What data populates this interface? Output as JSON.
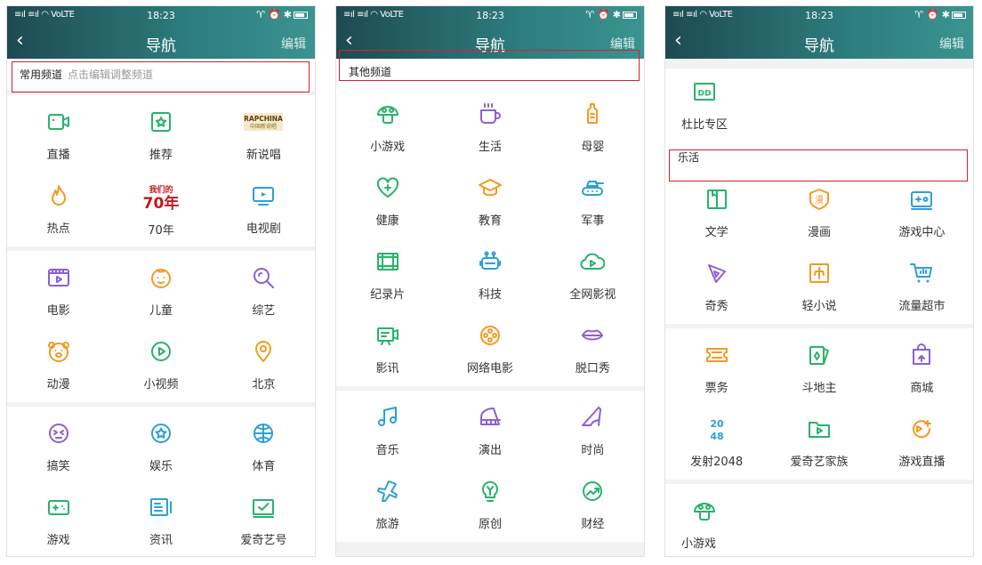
{
  "screens": [
    {
      "status": {
        "signal": "≡ıl ≡ıl ◠ VoLTE",
        "time": "18:23",
        "right": "♈ ⏰ ✱"
      },
      "nav": {
        "back": "‹",
        "title": "导航",
        "edit": "编辑"
      },
      "section_title": "常用频道",
      "section_hint": "点击编辑调整频道",
      "blocks": [
        [
          {
            "label": "直播",
            "icon": "live-icon",
            "color": "#27b36b"
          },
          {
            "label": "推荐",
            "icon": "recommend-icon",
            "color": "#27b36b"
          },
          {
            "label": "新说唱",
            "icon": "rapchina-logo",
            "color": "#8a6b1f"
          },
          {
            "label": "热点",
            "icon": "flame-icon",
            "color": "#f39a22"
          },
          {
            "label": "70年",
            "icon": "70-years-logo",
            "color": "#c4161c"
          },
          {
            "label": "电视剧",
            "icon": "tv-icon",
            "color": "#2d9fd8"
          }
        ],
        [
          {
            "label": "电影",
            "icon": "film-icon",
            "color": "#8e5fd0"
          },
          {
            "label": "儿童",
            "icon": "child-face-icon",
            "color": "#f39a22"
          },
          {
            "label": "综艺",
            "icon": "magnifier-icon",
            "color": "#8e5fd0"
          },
          {
            "label": "动漫",
            "icon": "bear-icon",
            "color": "#f39a22"
          },
          {
            "label": "小视频",
            "icon": "play-circle-icon",
            "color": "#27b36b"
          },
          {
            "label": "北京",
            "icon": "location-pin-icon",
            "color": "#f39a22"
          }
        ],
        [
          {
            "label": "搞笑",
            "icon": "funny-face-icon",
            "color": "#8e5fd0"
          },
          {
            "label": "娱乐",
            "icon": "star-circle-icon",
            "color": "#2d9fd8"
          },
          {
            "label": "体育",
            "icon": "ball-icon",
            "color": "#2d9fd8"
          },
          {
            "label": "游戏",
            "icon": "gamepad-icon",
            "color": "#27b36b"
          },
          {
            "label": "资讯",
            "icon": "news-icon",
            "color": "#2d9fd8"
          },
          {
            "label": "爱奇艺号",
            "icon": "check-box-icon",
            "color": "#27b36b"
          }
        ]
      ]
    },
    {
      "status": {
        "signal": "≡ıl ≡ıl ◠ VoLTE",
        "time": "18:23",
        "right": "♈ ⏰ ✱"
      },
      "nav": {
        "back": "‹",
        "title": "导航",
        "edit": "编辑"
      },
      "section_title": "其他频道",
      "blocks": [
        [
          {
            "label": "小游戏",
            "icon": "mushroom-icon",
            "color": "#27b36b"
          },
          {
            "label": "生活",
            "icon": "cup-icon",
            "color": "#8e5fd0"
          },
          {
            "label": "母婴",
            "icon": "baby-bottle-icon",
            "color": "#f39a22"
          },
          {
            "label": "健康",
            "icon": "heart-icon",
            "color": "#27b36b"
          },
          {
            "label": "教育",
            "icon": "graduation-cap-icon",
            "color": "#f39a22"
          },
          {
            "label": "军事",
            "icon": "tank-icon",
            "color": "#2d9fd8"
          },
          {
            "label": "纪录片",
            "icon": "filmstrip-icon",
            "color": "#27b36b"
          },
          {
            "label": "科技",
            "icon": "robot-icon",
            "color": "#2d9fd8"
          },
          {
            "label": "全网影视",
            "icon": "cloud-play-icon",
            "color": "#27b36b"
          },
          {
            "label": "影讯",
            "icon": "camera-screen-icon",
            "color": "#27b36b"
          },
          {
            "label": "网络电影",
            "icon": "film-reel-icon",
            "color": "#f39a22"
          },
          {
            "label": "脱口秀",
            "icon": "lips-icon",
            "color": "#8e5fd0"
          }
        ],
        [
          {
            "label": "音乐",
            "icon": "music-note-icon",
            "color": "#2d9fd8"
          },
          {
            "label": "演出",
            "icon": "piano-icon",
            "color": "#8e5fd0"
          },
          {
            "label": "时尚",
            "icon": "high-heel-icon",
            "color": "#8e5fd0"
          },
          {
            "label": "旅游",
            "icon": "plane-icon",
            "color": "#2d9fd8"
          },
          {
            "label": "原创",
            "icon": "bulb-icon",
            "color": "#27b36b"
          },
          {
            "label": "财经",
            "icon": "trend-icon",
            "color": "#27b36b"
          }
        ]
      ]
    },
    {
      "status": {
        "signal": "≡ıl ≡ıl ◠ VoLTE",
        "time": "18:23",
        "right": "♈ ⏰ ✱"
      },
      "nav": {
        "back": "‹",
        "title": "导航",
        "edit": "编辑"
      },
      "top_block": [
        {
          "label": "杜比专区",
          "icon": "dolby-icon",
          "color": "#27b36b"
        }
      ],
      "section_title": "乐活",
      "blocks": [
        [
          {
            "label": "文学",
            "icon": "book-icon",
            "color": "#27b36b"
          },
          {
            "label": "漫画",
            "icon": "manhua-icon",
            "color": "#f39a22",
            "glyph": "漫"
          },
          {
            "label": "游戏中心",
            "icon": "game-center-icon",
            "color": "#2d9fd8"
          },
          {
            "label": "奇秀",
            "icon": "qixiu-icon",
            "color": "#8e5fd0"
          },
          {
            "label": "轻小说",
            "icon": "light-novel-icon",
            "color": "#f39a22"
          },
          {
            "label": "流量超市",
            "icon": "cart-icon",
            "color": "#2d9fd8"
          }
        ],
        [
          {
            "label": "票务",
            "icon": "ticket-icon",
            "color": "#f39a22"
          },
          {
            "label": "斗地主",
            "icon": "cards-icon",
            "color": "#27b36b"
          },
          {
            "label": "商城",
            "icon": "shop-bag-icon",
            "color": "#8e5fd0"
          },
          {
            "label": "发射2048",
            "icon": "2048-icon",
            "color": "#2d9fd8"
          },
          {
            "label": "爱奇艺家族",
            "icon": "folder-play-icon",
            "color": "#27b36b"
          },
          {
            "label": "游戏直播",
            "icon": "game-live-icon",
            "color": "#f39a22"
          }
        ],
        [
          {
            "label": "小游戏",
            "icon": "mushroom-icon",
            "color": "#27b36b"
          }
        ]
      ]
    }
  ],
  "logos": {
    "rapchina_line1": "RAPCHINA",
    "rapchina_line2": "中国新说唱",
    "years_line1": "我们的",
    "years_line2": "70年",
    "dolby": "DD",
    "num_2048_top": "20",
    "num_2048_bottom": "48"
  }
}
